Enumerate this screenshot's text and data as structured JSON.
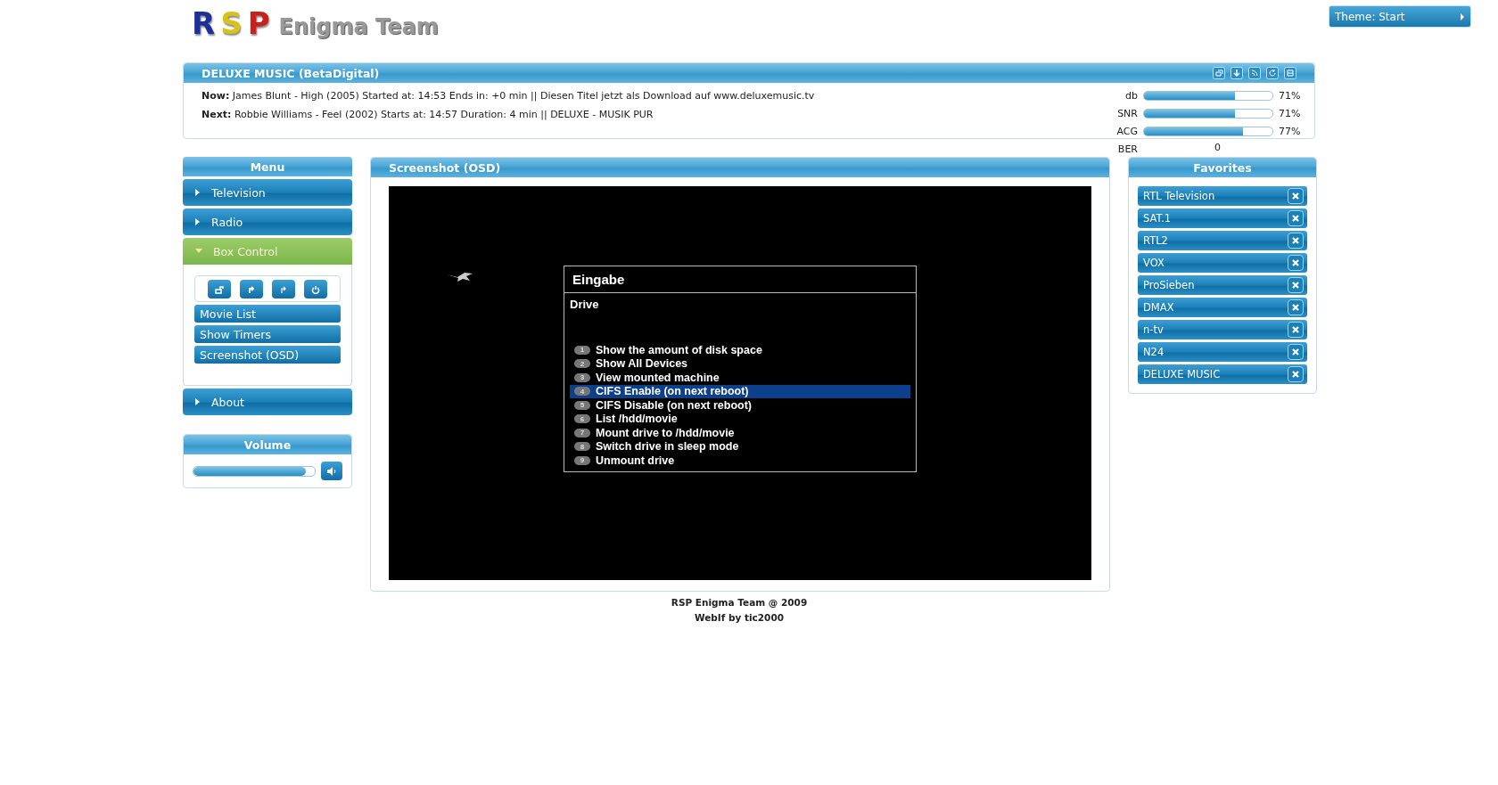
{
  "logo": {
    "letters": [
      {
        "text": "R",
        "color": "#1f2f9a"
      },
      {
        "text": "S",
        "color": "#d8c21a"
      },
      {
        "text": "P",
        "color": "#c8201c"
      }
    ],
    "name": "Enigma Team"
  },
  "theme_button": {
    "label": "Theme: Start"
  },
  "channel_panel": {
    "title": "DELUXE MUSIC (BetaDigital)",
    "now": {
      "label": "Now:",
      "text": "James Blunt - High (2005) Started at: 14:53 Ends in: +0 min || Diesen Titel jetzt als Download auf www.deluxemusic.tv"
    },
    "next": {
      "label": "Next:",
      "text": "Robbie Williams - Feel (2002) Starts at: 14:57 Duration: 4 min || DELUXE - MUSIK PUR"
    },
    "meters": [
      {
        "kind": "bar",
        "name": "db",
        "level": 0.71,
        "reading": "71%"
      },
      {
        "kind": "bar",
        "name": "SNR",
        "level": 0.71,
        "reading": "71%"
      },
      {
        "kind": "bar",
        "name": "ACG",
        "level": 0.77,
        "reading": "77%"
      },
      {
        "kind": "value",
        "name": "BER",
        "reading": "0"
      }
    ]
  },
  "menu": {
    "title": "Menu",
    "items": [
      {
        "label": "Television",
        "expanded": false
      },
      {
        "label": "Radio",
        "expanded": false
      },
      {
        "label": "Box Control",
        "expanded": true,
        "subitems": [
          "Movie List",
          "Show Timers",
          "Screenshot (OSD)"
        ]
      },
      {
        "label": "About",
        "expanded": false
      }
    ]
  },
  "volume": {
    "title": "Volume",
    "level": 0.93
  },
  "screenshot_panel": {
    "title": "Screenshot (OSD)",
    "osd": {
      "title": "Eingabe",
      "subtitle": "Drive",
      "items": [
        {
          "number": "1",
          "label": "Show the amount of disk space",
          "selected": false
        },
        {
          "number": "2",
          "label": "Show All Devices",
          "selected": false
        },
        {
          "number": "3",
          "label": "View mounted machine",
          "selected": false
        },
        {
          "number": "4",
          "label": "CIFS Enable (on next reboot)",
          "selected": true
        },
        {
          "number": "5",
          "label": "CIFS Disable (on next reboot)",
          "selected": false
        },
        {
          "number": "6",
          "label": "List /hdd/movie",
          "selected": false
        },
        {
          "number": "7",
          "label": "Mount drive to /hdd/movie",
          "selected": false
        },
        {
          "number": "8",
          "label": "Switch drive in sleep mode",
          "selected": false
        },
        {
          "number": "9",
          "label": "Unmount drive",
          "selected": false
        }
      ]
    }
  },
  "favorites": {
    "title": "Favorites",
    "items": [
      "RTL Television",
      "SAT.1",
      "RTL2",
      "VOX",
      "ProSieben",
      "DMAX",
      "n-tv",
      "N24",
      "DELUXE MUSIC"
    ]
  },
  "footer": [
    "RSP Enigma Team @ 2009",
    "WebIf by tic2000"
  ]
}
